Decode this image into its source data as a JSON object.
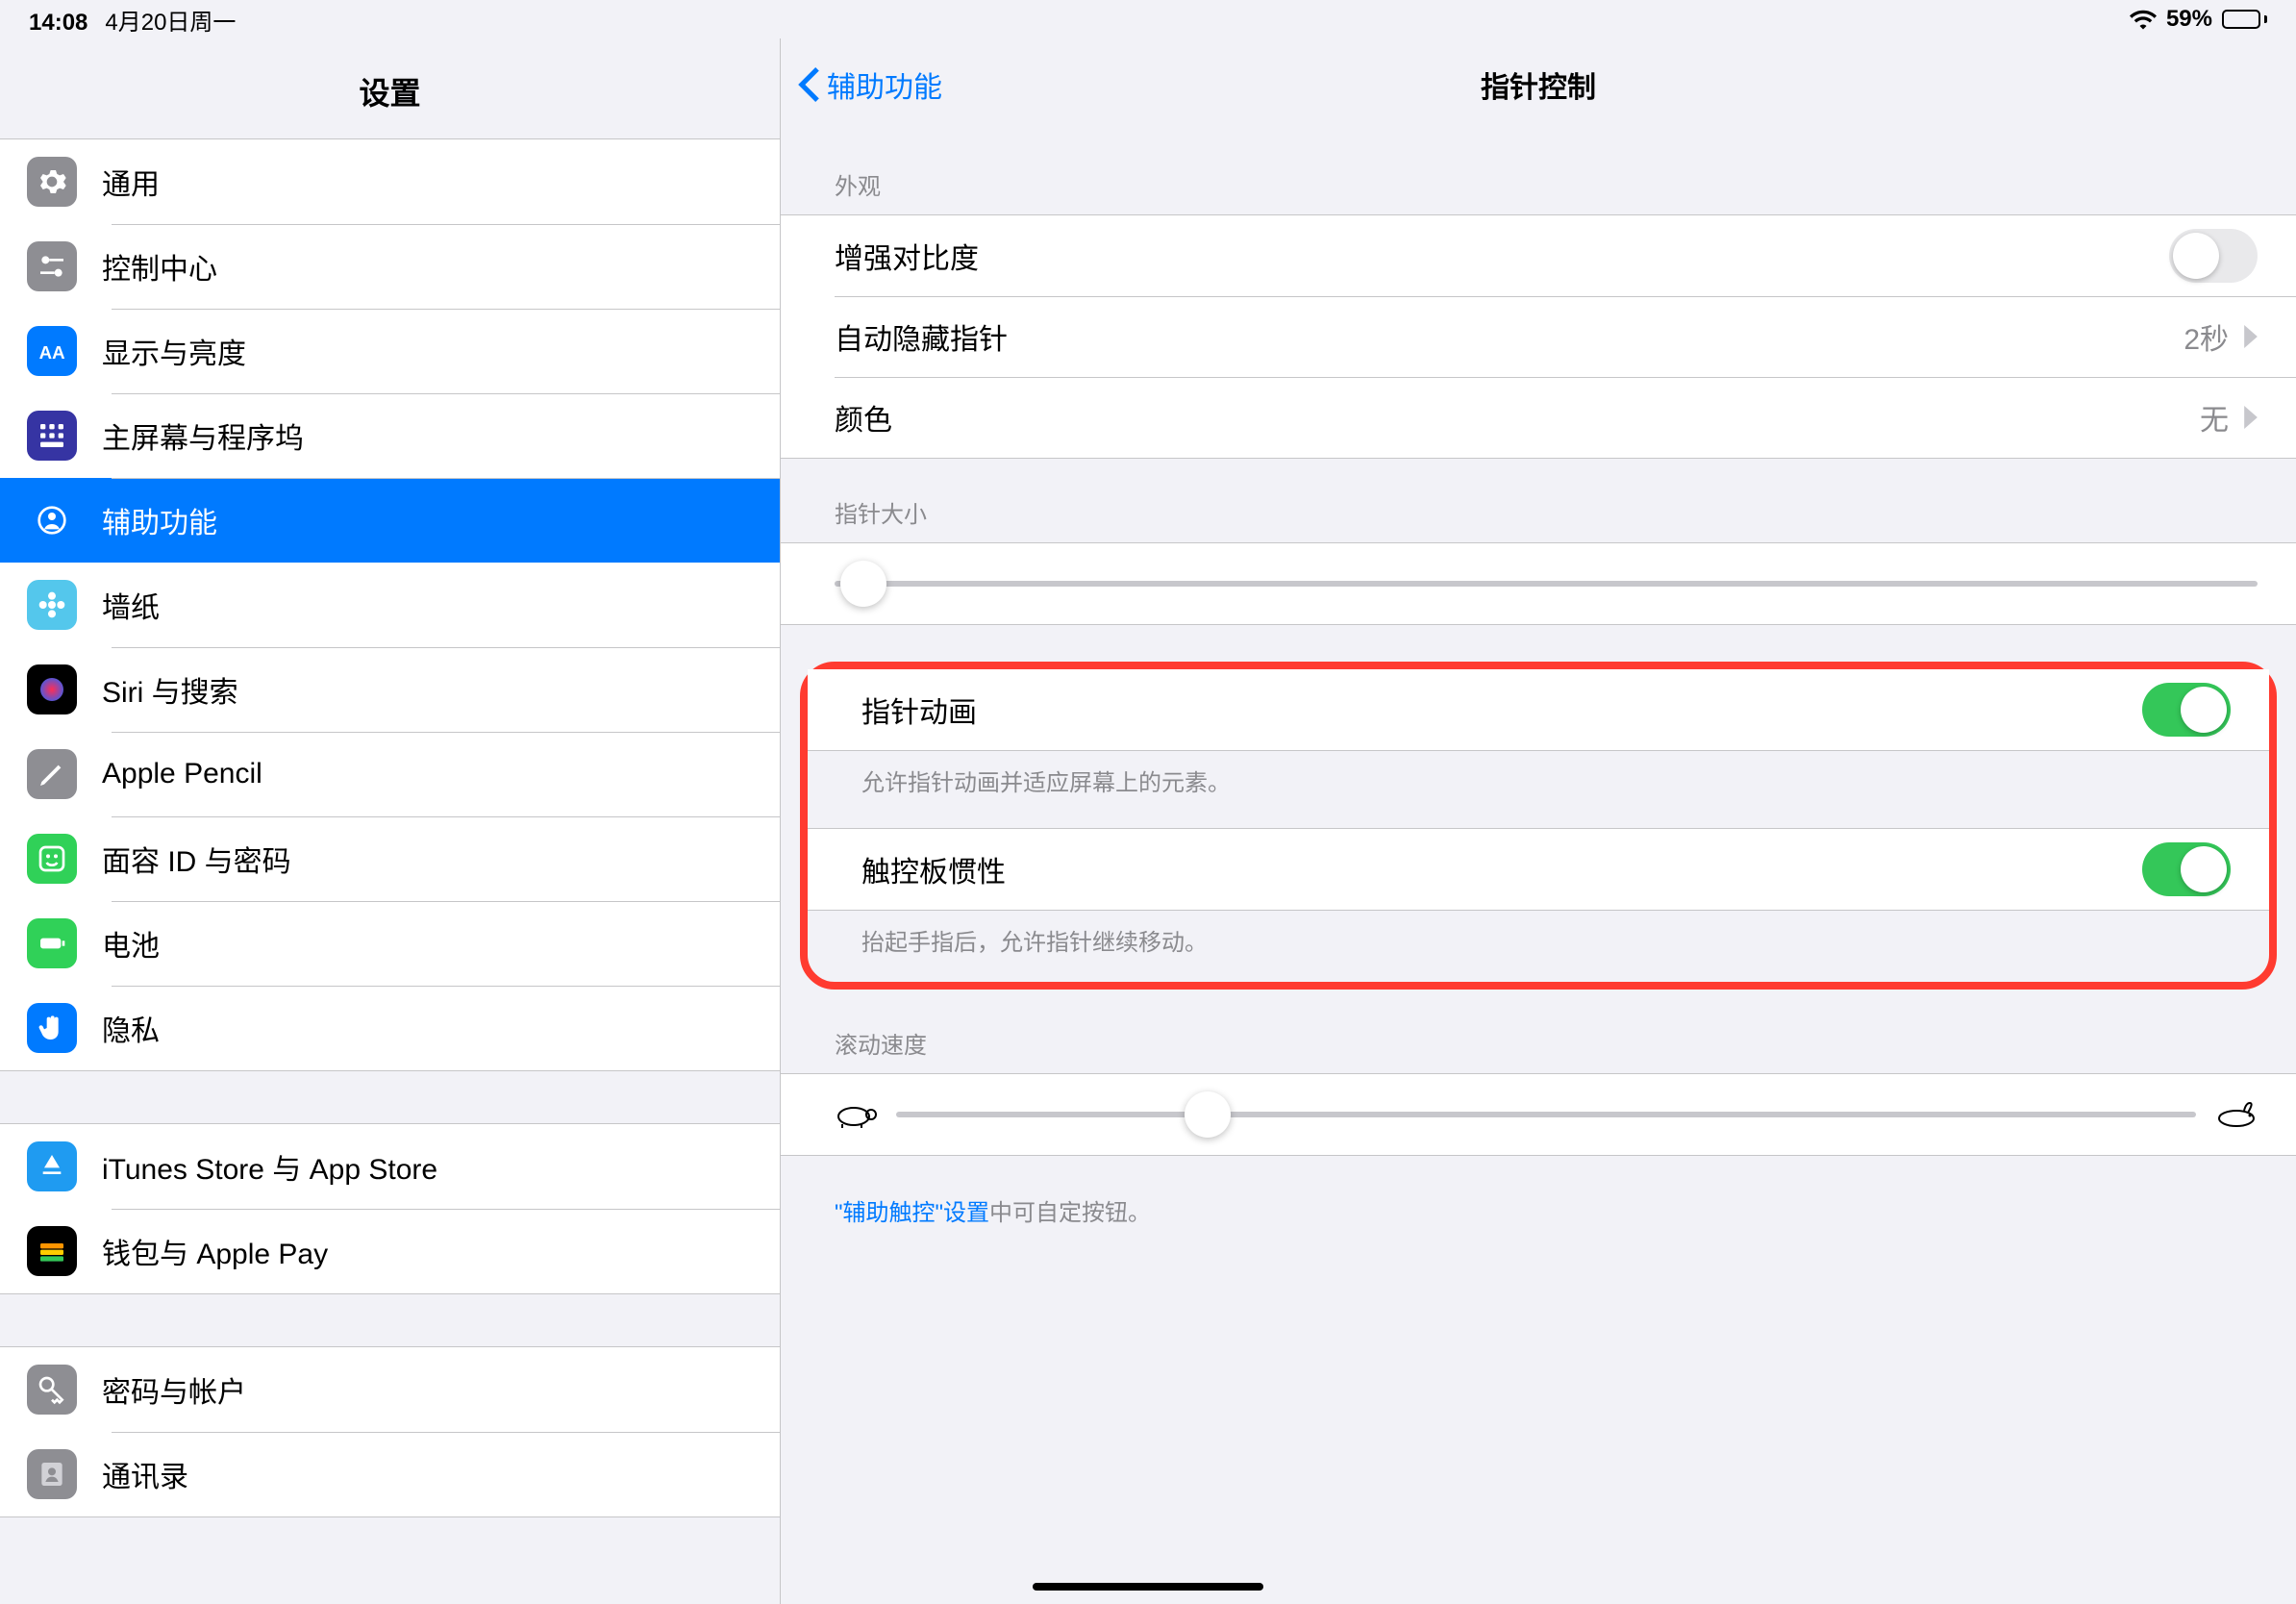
{
  "status": {
    "time": "14:08",
    "date": "4月20日周一",
    "battery_pct": "59%"
  },
  "sidebar": {
    "title": "设置",
    "groups": [
      {
        "items": [
          {
            "key": "general",
            "label": "通用",
            "icon": "gear",
            "bg": "#8e8e93"
          },
          {
            "key": "control-center",
            "label": "控制中心",
            "icon": "switches",
            "bg": "#8e8e93"
          },
          {
            "key": "display",
            "label": "显示与亮度",
            "icon": "aa",
            "bg": "#007aff"
          },
          {
            "key": "home-screen",
            "label": "主屏幕与程序坞",
            "icon": "grid",
            "bg": "#3634a3"
          },
          {
            "key": "accessibility",
            "label": "辅助功能",
            "icon": "person",
            "bg": "#007aff",
            "selected": true
          },
          {
            "key": "wallpaper",
            "label": "墙纸",
            "icon": "flower",
            "bg": "#54c7ec"
          },
          {
            "key": "siri",
            "label": "Siri 与搜索",
            "icon": "siri",
            "bg": "#000"
          },
          {
            "key": "pencil",
            "label": "Apple Pencil",
            "icon": "pencil",
            "bg": "#8e8e93"
          },
          {
            "key": "faceid",
            "label": "面容 ID 与密码",
            "icon": "face",
            "bg": "#30d158"
          },
          {
            "key": "battery",
            "label": "电池",
            "icon": "battery",
            "bg": "#30d158"
          },
          {
            "key": "privacy",
            "label": "隐私",
            "icon": "hand",
            "bg": "#007aff"
          }
        ]
      },
      {
        "items": [
          {
            "key": "itunes",
            "label": "iTunes Store 与 App Store",
            "icon": "appstore",
            "bg": "#1f9bf1"
          },
          {
            "key": "wallet",
            "label": "钱包与 Apple Pay",
            "icon": "wallet",
            "bg": "#000"
          }
        ]
      },
      {
        "items": [
          {
            "key": "passwords",
            "label": "密码与帐户",
            "icon": "key",
            "bg": "#8e8e93"
          },
          {
            "key": "contacts",
            "label": "通讯录",
            "icon": "contacts",
            "bg": "#8e8e93"
          }
        ]
      }
    ]
  },
  "detail": {
    "back": "辅助功能",
    "title": "指针控制",
    "appearance_header": "外观",
    "contrast": {
      "label": "增强对比度",
      "on": false
    },
    "autohide": {
      "label": "自动隐藏指针",
      "value": "2秒"
    },
    "color": {
      "label": "颜色",
      "value": "无"
    },
    "pointer_size_header": "指针大小",
    "pointer_size_value": 0.02,
    "pointer_anim": {
      "label": "指针动画",
      "on": true,
      "footer": "允许指针动画并适应屏幕上的元素。"
    },
    "trackpad_inertia": {
      "label": "触控板惯性",
      "on": true,
      "footer": "抬起手指后，允许指针继续移动。"
    },
    "scroll_header": "滚动速度",
    "scroll_value": 0.24,
    "footer_link": "\"辅助触控\"设置",
    "footer_rest": "中可自定按钮。"
  }
}
